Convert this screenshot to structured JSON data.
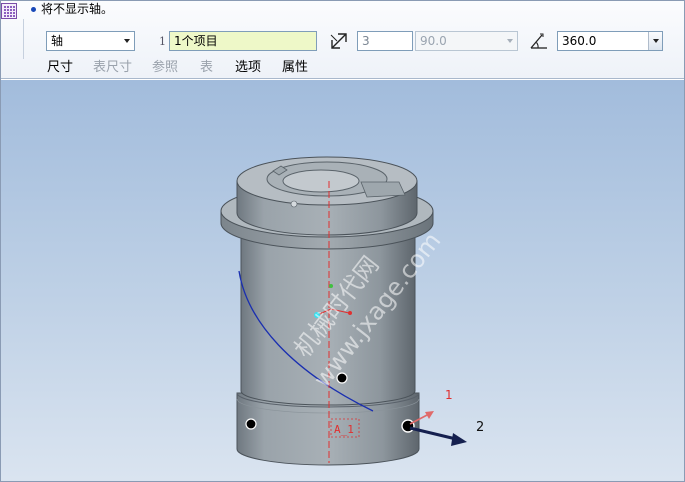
{
  "message": {
    "text": "将不显示轴。"
  },
  "controls": {
    "pattern_type": "轴",
    "reference_index": "1",
    "reference_selection": "1个项目",
    "member_count": "3",
    "increment_angle": "90.0",
    "extent_angle": "360.0"
  },
  "tabs": [
    {
      "label": "尺寸",
      "enabled": true
    },
    {
      "label": "表尺寸",
      "enabled": false
    },
    {
      "label": "参照",
      "enabled": false
    },
    {
      "label": "表",
      "enabled": false
    },
    {
      "label": "选项",
      "enabled": true
    },
    {
      "label": "属性",
      "enabled": true
    }
  ],
  "viewport": {
    "axis_label": "A_1",
    "direction_1_label": "1",
    "direction_2_label": "2",
    "watermark_line_1": "机械时代网",
    "watermark_line_2": "www.jxage.com"
  },
  "colors": {
    "selection_highlight": "#eef8c8",
    "axis_red": "#e03030",
    "curve_blue": "#1a2fb0",
    "arrow_navy": "#15204f"
  },
  "icons": {
    "feature": "pattern-grid-icon",
    "flip": "flip-direction-icon",
    "angle": "angle-extent-icon"
  }
}
